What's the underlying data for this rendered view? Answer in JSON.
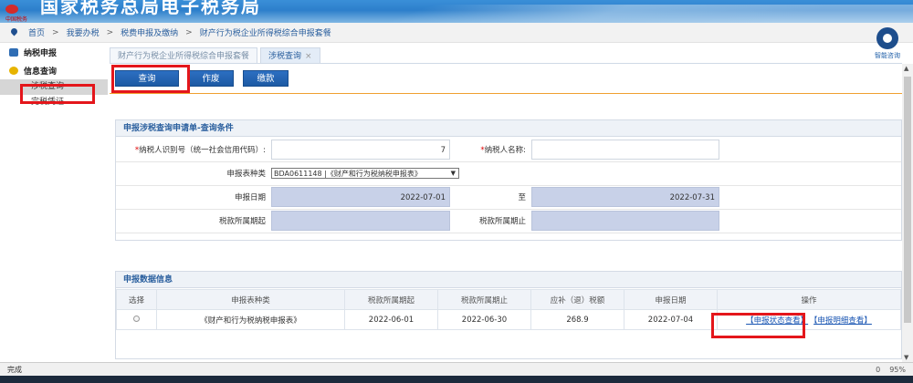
{
  "banner": {
    "logo_text": "中国税务",
    "title": "国家税务总局电子税务局"
  },
  "breadcrumb": {
    "items": [
      "首页",
      "我要办税",
      "税费申报及缴纳",
      "财产行为税企业所得税综合申报套餐"
    ],
    "sep": ">"
  },
  "sidebar": {
    "groups": [
      {
        "label": "纳税申报"
      },
      {
        "label": "信息查询"
      }
    ],
    "items": [
      "涉税查询",
      "完税凭证"
    ]
  },
  "tabs": [
    "财产行为税企业所得税综合申报套餐",
    "涉税查询"
  ],
  "tab_close": "×",
  "toolbar": {
    "query": "查询",
    "void": "作废",
    "pay": "缴款"
  },
  "help": {
    "label": "智能咨询"
  },
  "query_panel": {
    "title": "申报涉税查询申请单-查询条件",
    "taxpayer_id_label": "纳税人识别号（统一社会信用代码）:",
    "taxpayer_id_req": "*",
    "taxpayer_id_value": "7",
    "taxpayer_name_label": "纳税人名称:",
    "taxpayer_name_req": "*",
    "taxpayer_name_value": "",
    "form_type_label": "申报表种类",
    "form_type_value": "BDA0611148 |《财产和行为税纳税申报表》",
    "form_type_arrow": "▼",
    "date_label": "申报日期",
    "date_from": "2022-07-01",
    "date_to_label": "至",
    "date_to": "2022-07-31",
    "period_start_label": "税款所属期起",
    "period_start_value": "",
    "period_end_label": "税款所属期止",
    "period_end_value": ""
  },
  "data_panel": {
    "title": "申报数据信息",
    "headers": [
      "选择",
      "申报表种类",
      "税款所属期起",
      "税款所属期止",
      "应补（退）税额",
      "申报日期",
      "操作"
    ],
    "rows": [
      {
        "form": "《财产和行为税纳税申报表》",
        "start": "2022-06-01",
        "end": "2022-06-30",
        "amount": "268.9",
        "date": "2022-07-04",
        "action_status": "【申报状态查看】",
        "action_detail": "【申报明细查看】"
      }
    ]
  },
  "statusbar": {
    "left": "完成",
    "zoom": "95%",
    "count": "0"
  }
}
